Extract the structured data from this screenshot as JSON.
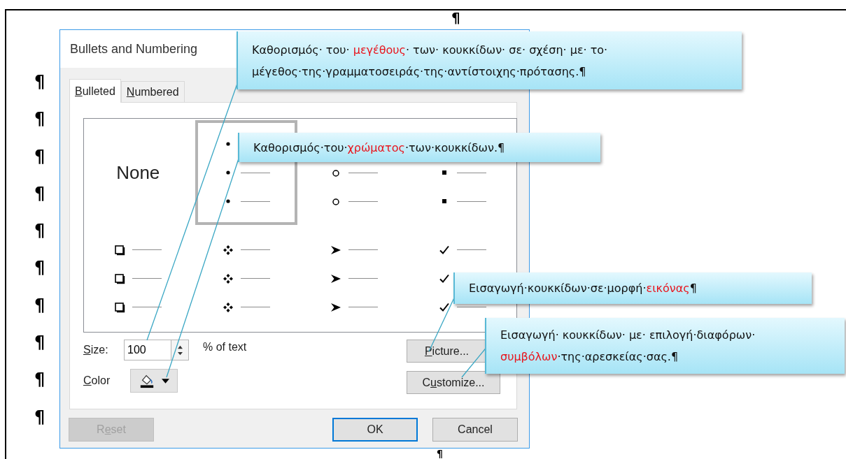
{
  "document": {
    "pilcrows": [
      "¶",
      "¶",
      "¶",
      "¶",
      "¶",
      "¶",
      "¶",
      "¶",
      "¶",
      "¶"
    ],
    "pilcrow_top": "¶",
    "pilcrow_bottom": "¶"
  },
  "dialog": {
    "title": "Bullets and Numbering",
    "tabs": [
      {
        "access_key": "B",
        "label_rest": "ulleted",
        "selected": true
      },
      {
        "access_key": "N",
        "label_rest": "umbered",
        "selected": false
      }
    ],
    "gallery": {
      "options": [
        {
          "kind": "none",
          "label": "None",
          "selected": false
        },
        {
          "kind": "dot",
          "selected": true
        },
        {
          "kind": "circle",
          "selected": false
        },
        {
          "kind": "square",
          "selected": false
        },
        {
          "kind": "box",
          "selected": false
        },
        {
          "kind": "diamond",
          "selected": false
        },
        {
          "kind": "arrow",
          "selected": false
        },
        {
          "kind": "check",
          "selected": false
        }
      ]
    },
    "size": {
      "access_key": "S",
      "label_rest": "ize:",
      "value": "100",
      "unit": "% of text"
    },
    "color": {
      "access_key": "C",
      "label_rest": "olor"
    },
    "side_buttons": [
      {
        "access_key": "P",
        "label_rest": "icture..."
      },
      {
        "label_start": "C",
        "access_key": "u",
        "label_rest": "stomize..."
      }
    ],
    "footer_buttons": [
      {
        "label_start": "R",
        "access_key": "e",
        "label_rest": "set",
        "disabled": true,
        "default": false
      },
      {
        "label": "OK",
        "disabled": false,
        "default": true
      },
      {
        "label": "Cancel",
        "disabled": false,
        "default": false
      }
    ]
  },
  "callouts": [
    {
      "segments": [
        {
          "text": "Καθορισμός· του· ",
          "highlight": false
        },
        {
          "text": "μεγέθους",
          "highlight": true
        },
        {
          "text": "· των· κουκκίδων· σε· σχέση· με· το· μέγεθος·της·γραμματοσειράς·της·αντίστοιχης·πρότασης.¶",
          "highlight": false
        }
      ]
    },
    {
      "segments": [
        {
          "text": "Καθορισμός·του·",
          "highlight": false
        },
        {
          "text": "χρώματος",
          "highlight": true
        },
        {
          "text": "·των·κουκκίδων.¶",
          "highlight": false
        }
      ]
    },
    {
      "segments": [
        {
          "text": "Εισαγωγή·κουκκίδων·σε·μορφή·",
          "highlight": false
        },
        {
          "text": "εικόνας",
          "highlight": true
        },
        {
          "text": "¶",
          "highlight": false
        }
      ]
    },
    {
      "segments": [
        {
          "text": "Εισαγωγή· κουκκίδων· με· επιλογή·διαφόρων· ",
          "highlight": false
        },
        {
          "text": "συμβόλων",
          "highlight": true
        },
        {
          "text": "·της·αρεσκείας·σας.¶",
          "highlight": false
        }
      ]
    }
  ]
}
